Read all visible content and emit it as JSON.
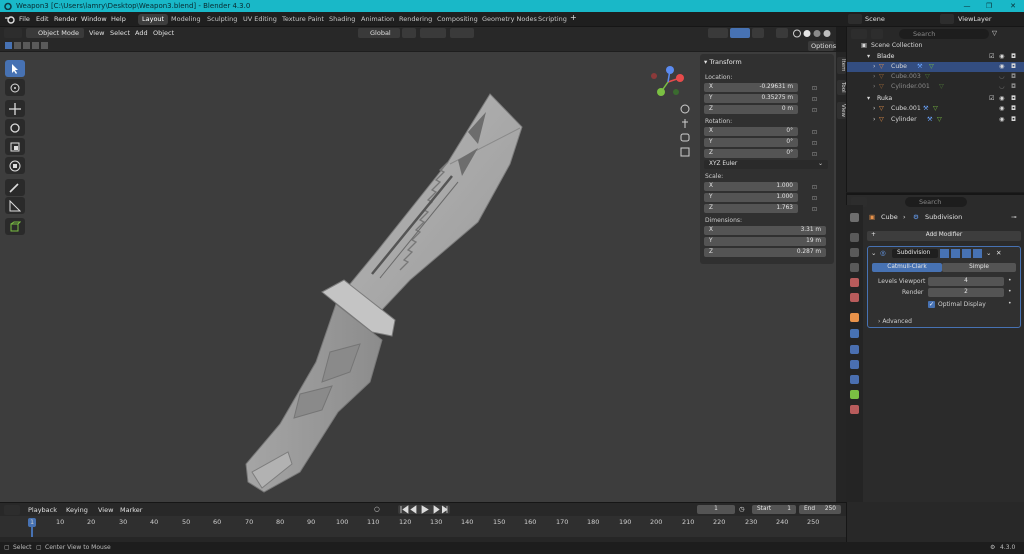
{
  "window": {
    "title": "Weapon3 [C:\\Users\\lamry\\Desktop\\Weapon3.blend] - Blender 4.3.0",
    "controls": [
      "—",
      "❐",
      "✕"
    ]
  },
  "menu": [
    "File",
    "Edit",
    "Render",
    "Window",
    "Help"
  ],
  "workspaces": [
    "Layout",
    "Modeling",
    "Sculpting",
    "UV Editing",
    "Texture Paint",
    "Shading",
    "Animation",
    "Rendering",
    "Compositing",
    "Geometry Nodes",
    "Scripting"
  ],
  "active_workspace": "Layout",
  "scene": {
    "label": "Scene",
    "view_layer": "ViewLayer"
  },
  "viewport_header": {
    "mode": "Object Mode",
    "menus": [
      "View",
      "Select",
      "Add",
      "Object"
    ],
    "orientation": "Global",
    "options": "Options"
  },
  "npanel": {
    "tabs": [
      "Item",
      "Tool",
      "View"
    ],
    "section": "Transform",
    "location_label": "Location:",
    "location": [
      {
        "axis": "X",
        "value": "-0.29631 m"
      },
      {
        "axis": "Y",
        "value": "0.35275 m"
      },
      {
        "axis": "Z",
        "value": "0 m"
      }
    ],
    "rotation_label": "Rotation:",
    "rotation": [
      {
        "axis": "X",
        "value": "0°"
      },
      {
        "axis": "Y",
        "value": "0°"
      },
      {
        "axis": "Z",
        "value": "0°"
      }
    ],
    "rotation_mode": "XYZ Euler",
    "scale_label": "Scale:",
    "scale": [
      {
        "axis": "X",
        "value": "1.000"
      },
      {
        "axis": "Y",
        "value": "1.000"
      },
      {
        "axis": "Z",
        "value": "1.763"
      }
    ],
    "dimensions_label": "Dimensions:",
    "dimensions": [
      {
        "axis": "X",
        "value": "3.31 m"
      },
      {
        "axis": "Y",
        "value": "19 m"
      },
      {
        "axis": "Z",
        "value": "0.287 m"
      }
    ]
  },
  "outliner": {
    "search_placeholder": "Search",
    "root": "Scene Collection",
    "rows": [
      {
        "name": "Blade",
        "type": "collection",
        "indent": 0
      },
      {
        "name": "Cube",
        "type": "mesh",
        "indent": 1
      },
      {
        "name": "Cube.003",
        "type": "mesh",
        "indent": 1,
        "dim": true
      },
      {
        "name": "Cylinder.001",
        "type": "mesh",
        "indent": 1,
        "dim": true
      },
      {
        "name": "Ruka",
        "type": "collection",
        "indent": 0
      },
      {
        "name": "Cube.001",
        "type": "mesh",
        "indent": 1
      },
      {
        "name": "Cylinder",
        "type": "mesh",
        "indent": 1
      }
    ]
  },
  "properties": {
    "search_placeholder": "Search",
    "breadcrumb_object": "Cube",
    "breadcrumb_modifier": "Subdivision",
    "add_modifier": "Add Modifier",
    "modifier_name": "Subdivision",
    "tabs": [
      "Catmull-Clark",
      "Simple"
    ],
    "active_tab": "Catmull-Clark",
    "levels_viewport_label": "Levels Viewport",
    "levels_viewport": "4",
    "render_label": "Render",
    "render": "2",
    "optimal_display": "Optimal Display",
    "advanced": "Advanced"
  },
  "timeline": {
    "menus": [
      "Playback",
      "Keying",
      "View",
      "Marker"
    ],
    "current_frame": "1",
    "start_label": "Start",
    "start": "1",
    "end_label": "End",
    "end": "250",
    "ticks": [
      "1",
      "10",
      "20",
      "30",
      "40",
      "50",
      "60",
      "70",
      "80",
      "90",
      "100",
      "110",
      "120",
      "130",
      "140",
      "150",
      "160",
      "170",
      "180",
      "190",
      "200",
      "210",
      "220",
      "230",
      "240",
      "250"
    ]
  },
  "statusbar": {
    "select": "Select",
    "center_view": "Center View to Mouse",
    "version": "4.3.0"
  },
  "colors": {
    "accent": "#4772b3",
    "title_bar": "#19b8c8",
    "mesh_orange": "#e8924a",
    "modifier_blue": "#6aa5ff"
  }
}
